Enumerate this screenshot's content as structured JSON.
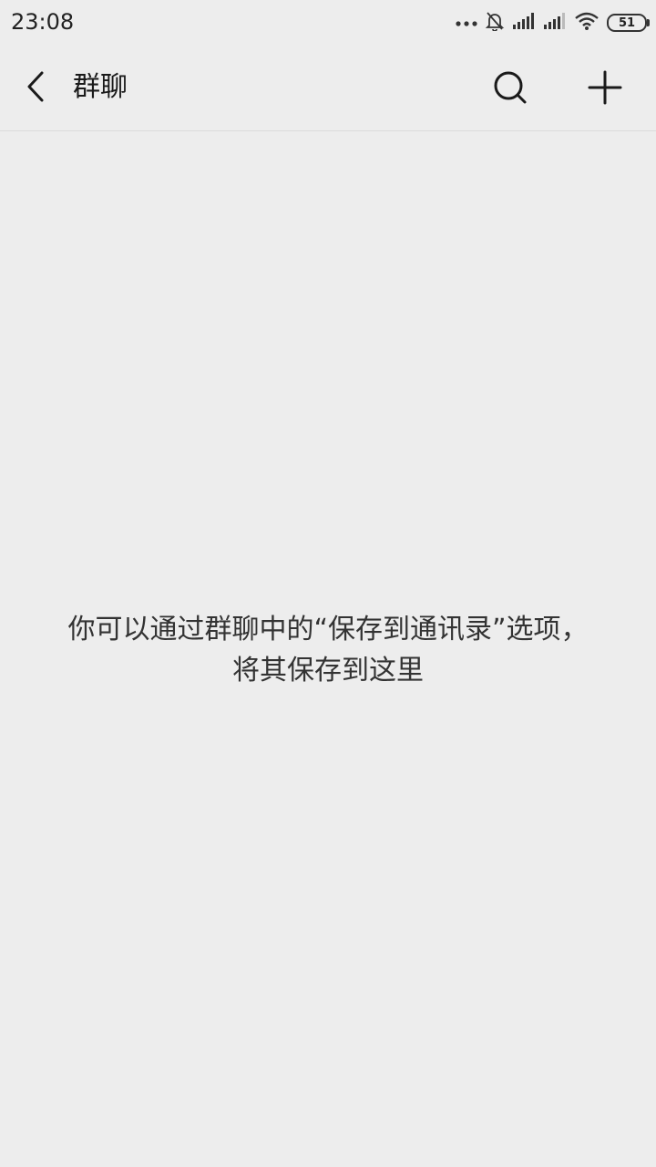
{
  "status_bar": {
    "time": "23:08",
    "icons": [
      "more-dots-icon",
      "bell-off-icon",
      "signal-icon",
      "signal-icon",
      "wifi-icon",
      "battery-icon"
    ],
    "battery_level": "51"
  },
  "nav": {
    "title": "群聊",
    "back_icon": "chevron-left-icon",
    "search_icon": "search-icon",
    "add_icon": "plus-icon"
  },
  "empty_state": {
    "line1": "你可以通过群聊中的“保存到通讯录”选项，",
    "line2": "将其保存到这里"
  },
  "colors": {
    "background": "#ededed",
    "text": "#1a1a1a",
    "divider": "#dcdcdc"
  }
}
